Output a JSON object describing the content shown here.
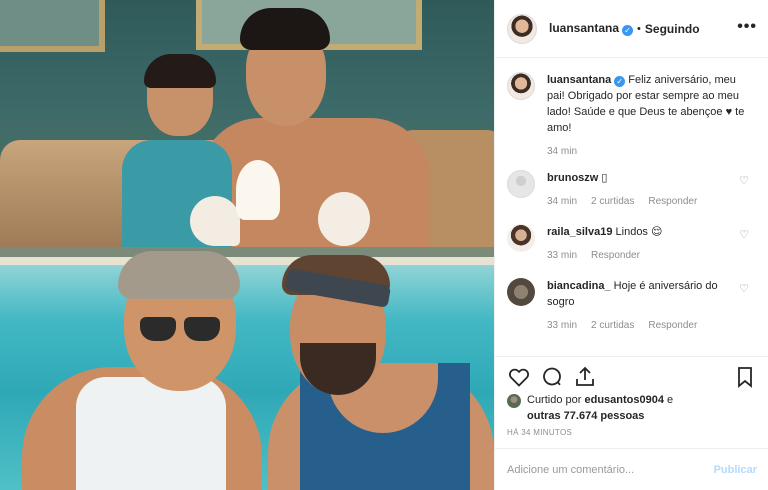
{
  "post": {
    "author": "luansantana",
    "follow_status": "Seguindo",
    "more_icon": "more-dots-icon",
    "caption": "Feliz aniversário, meu pai! Obrigado por estar sempre ao meu lado! Saúde e que Deus te abençoe ♥ te amo!",
    "caption_time": "34 min"
  },
  "comments": [
    {
      "user": "brunoszw",
      "text": "▯",
      "time": "34 min",
      "likes": "2 curtidas",
      "reply": "Responder"
    },
    {
      "user": "raila_silva19",
      "text": "Lindos 😌",
      "time": "33 min",
      "likes": "",
      "reply": "Responder"
    },
    {
      "user": "biancadina_",
      "text": "Hoje é aniversário do sogro",
      "time": "33 min",
      "likes": "2 curtidas",
      "reply": "Responder"
    }
  ],
  "likes": {
    "prefix": "Curtido por",
    "user": "edusantos0904",
    "joiner": "e",
    "others": "outras 77.674 pessoas"
  },
  "timestamp": "HÁ 34 MINUTOS",
  "comment_box": {
    "placeholder": "Adicione um comentário...",
    "publish": "Publicar"
  },
  "colors": {
    "verified": "#3897f0",
    "publish_disabled": "#b3dbff",
    "muted_text": "#8e8e8e"
  }
}
